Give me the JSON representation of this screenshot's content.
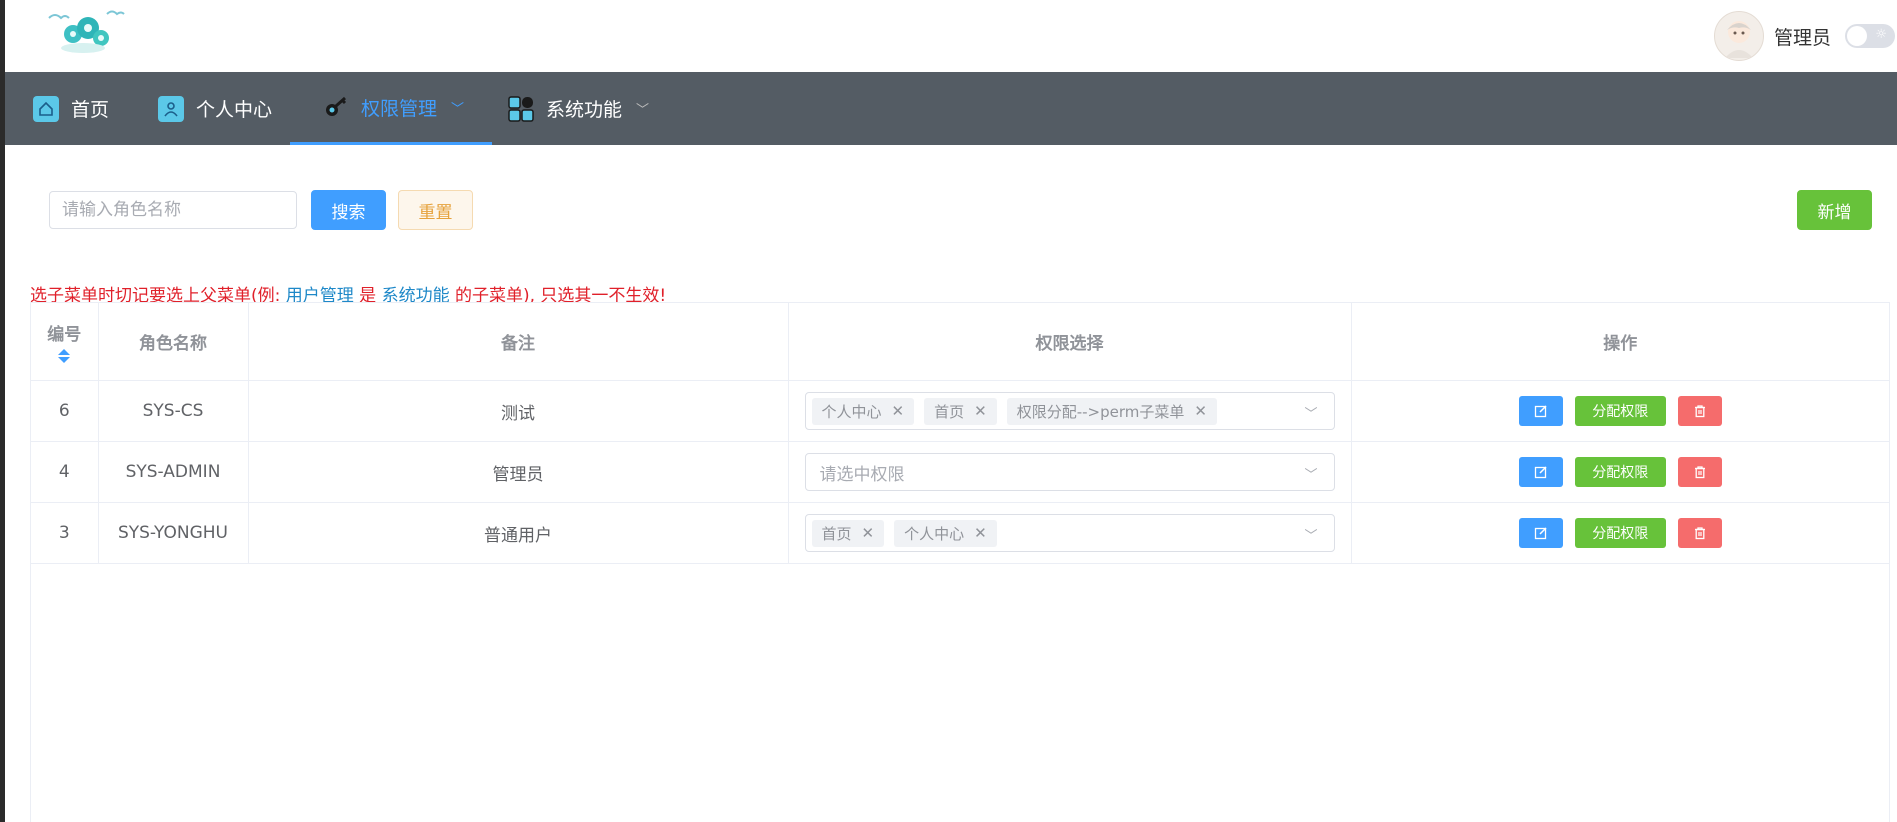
{
  "header": {
    "username": "管理员"
  },
  "nav": {
    "items": [
      {
        "label": "首页",
        "icon": "home-icon"
      },
      {
        "label": "个人中心",
        "icon": "user-icon"
      },
      {
        "label": "权限管理",
        "icon": "key-icon",
        "active": true
      },
      {
        "label": "系统功能",
        "icon": "grid-icon"
      }
    ]
  },
  "toolbar": {
    "search_placeholder": "请输入角色名称",
    "search_label": "搜索",
    "reset_label": "重置",
    "add_label": "新增"
  },
  "notice": {
    "part1": "选子菜单时切记要选上父菜单(例: ",
    "link1": "用户管理",
    "part2": " 是 ",
    "link2": "系统功能",
    "part3": " 的子菜单), 只选其一不生效!"
  },
  "table": {
    "columns": [
      "编号",
      "角色名称",
      "备注",
      "权限选择",
      "操作"
    ],
    "rows": [
      {
        "id": "6",
        "role": "SYS-CS",
        "remark": "测试",
        "perm_tags": [
          "个人中心",
          "首页",
          "权限分配-->perm子菜单"
        ]
      },
      {
        "id": "4",
        "role": "SYS-ADMIN",
        "remark": "管理员",
        "perm_tags": []
      },
      {
        "id": "3",
        "role": "SYS-YONGHU",
        "remark": "普通用户",
        "perm_tags": [
          "首页",
          "个人中心"
        ]
      }
    ],
    "perm_placeholder": "请选中权限",
    "assign_label": "分配权限"
  },
  "colors": {
    "primary": "#409eff",
    "success": "#67c23a",
    "danger": "#f56c6c",
    "warning": "#e6a23c",
    "nav_bg": "#545c64",
    "notice_red": "#e0202a"
  }
}
